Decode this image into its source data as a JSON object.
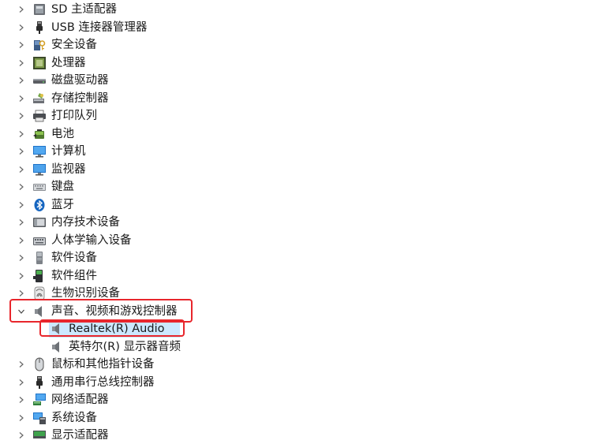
{
  "device_manager": {
    "items": [
      {
        "label": "SD 主适配器",
        "icon": "sd-host-adapter-icon",
        "expanded": false
      },
      {
        "label": "USB 连接器管理器",
        "icon": "usb-connector-icon",
        "expanded": false
      },
      {
        "label": "安全设备",
        "icon": "security-device-icon",
        "expanded": false
      },
      {
        "label": "处理器",
        "icon": "processor-icon",
        "expanded": false
      },
      {
        "label": "磁盘驱动器",
        "icon": "disk-drive-icon",
        "expanded": false
      },
      {
        "label": "存储控制器",
        "icon": "storage-controller-icon",
        "expanded": false
      },
      {
        "label": "打印队列",
        "icon": "printer-icon",
        "expanded": false
      },
      {
        "label": "电池",
        "icon": "battery-icon",
        "expanded": false
      },
      {
        "label": "计算机",
        "icon": "computer-icon",
        "expanded": false
      },
      {
        "label": "监视器",
        "icon": "monitor-icon",
        "expanded": false
      },
      {
        "label": "键盘",
        "icon": "keyboard-icon",
        "expanded": false
      },
      {
        "label": "蓝牙",
        "icon": "bluetooth-icon",
        "expanded": false
      },
      {
        "label": "内存技术设备",
        "icon": "memory-device-icon",
        "expanded": false
      },
      {
        "label": "人体学输入设备",
        "icon": "hid-icon",
        "expanded": false
      },
      {
        "label": "软件设备",
        "icon": "software-device-icon",
        "expanded": false
      },
      {
        "label": "软件组件",
        "icon": "software-component-icon",
        "expanded": false
      },
      {
        "label": "生物识别设备",
        "icon": "biometric-icon",
        "expanded": false
      },
      {
        "label": "声音、视频和游戏控制器",
        "icon": "speaker-icon",
        "expanded": true,
        "children": [
          {
            "label": "Realtek(R) Audio",
            "icon": "speaker-icon",
            "selected": true
          },
          {
            "label": "英特尔(R) 显示器音频",
            "icon": "speaker-icon",
            "selected": false
          }
        ]
      },
      {
        "label": "鼠标和其他指针设备",
        "icon": "mouse-icon",
        "expanded": false
      },
      {
        "label": "通用串行总线控制器",
        "icon": "usb-controller-icon",
        "expanded": false
      },
      {
        "label": "网络适配器",
        "icon": "network-adapter-icon",
        "expanded": false
      },
      {
        "label": "系统设备",
        "icon": "system-device-icon",
        "expanded": false
      },
      {
        "label": "显示适配器",
        "icon": "display-adapter-icon",
        "expanded": false
      }
    ]
  },
  "colors": {
    "highlight": "#e8262c",
    "selection": "#cce8ff"
  }
}
